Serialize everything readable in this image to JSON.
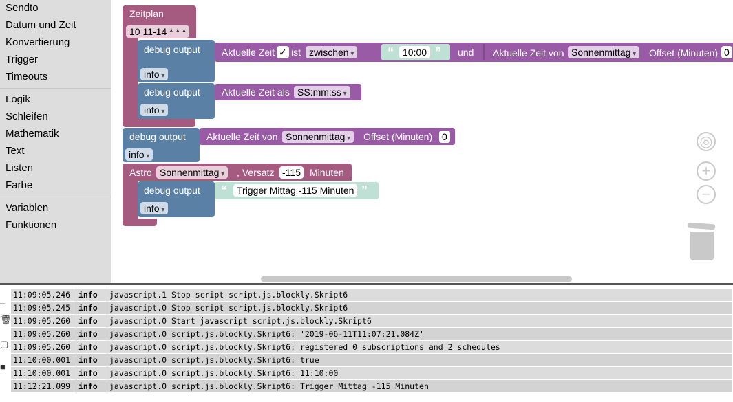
{
  "toolbox": {
    "groups": [
      [
        "Sendto",
        "Datum und Zeit",
        "Konvertierung",
        "Trigger",
        "Timeouts"
      ],
      [
        "Logik",
        "Schleifen",
        "Mathematik",
        "Text",
        "Listen",
        "Farbe"
      ],
      [
        "Variablen",
        "Funktionen"
      ]
    ]
  },
  "blocks": {
    "schedule": {
      "title": "Zeitplan",
      "cron": "10 11-14 * * *"
    },
    "debug1": {
      "label": "debug output",
      "level": "info",
      "value": {
        "prefix": "Aktuelle Zeit",
        "check": "✓",
        "ist": "ist",
        "mode": "zwischen",
        "time": "10:00",
        "und": "und",
        "from": "Aktuelle Zeit von",
        "sun": "Sonnenmittag",
        "offset": "Offset (Minuten)",
        "offset_val": "0"
      }
    },
    "debug2": {
      "label": "debug output",
      "level": "info",
      "value": {
        "prefix": "Aktuelle Zeit als",
        "format": "SS:mm:ss"
      }
    },
    "debug3": {
      "label": "debug output",
      "level": "info",
      "value": {
        "prefix": "Aktuelle Zeit von",
        "sun": "Sonnenmittag",
        "offset": "Offset (Minuten)",
        "offset_val": "0"
      }
    },
    "astro": {
      "title": "Astro",
      "sun": "Sonnenmittag",
      "versatz": ", Versatz",
      "versatz_val": "-115",
      "unit": "Minuten"
    },
    "debug4": {
      "label": "debug output",
      "level": "info",
      "text": "Trigger Mittag -115 Minuten"
    }
  },
  "log": {
    "rows": [
      [
        "11:09:05.246",
        "info",
        "javascript.1 Stop script script.js.blockly.Skript6"
      ],
      [
        "11:09:05.245",
        "info",
        "javascript.0 Stop script script.js.blockly.Skript6"
      ],
      [
        "11:09:05.260",
        "info",
        "javascript.0 Start javascript script.js.blockly.Skript6"
      ],
      [
        "11:09:05.260",
        "info",
        "javascript.0 script.js.blockly.Skript6: '2019-06-11T11:07:21.084Z'"
      ],
      [
        "11:09:05.260",
        "info",
        "javascript.0 script.js.blockly.Skript6: registered 0 subscriptions and 2 schedules"
      ],
      [
        "11:10:00.001",
        "info",
        "javascript.0 script.js.blockly.Skript6: true"
      ],
      [
        "11:10:00.001",
        "info",
        "javascript.0 script.js.blockly.Skript6: 11:10:00"
      ],
      [
        "11:12:21.099",
        "info",
        "javascript.0 script.js.blockly.Skript6: Trigger Mittag -115 Minuten"
      ]
    ]
  },
  "icons": {
    "center": "target-icon",
    "zoom_in": "zoom-in-icon",
    "zoom_out": "zoom-out-icon",
    "trash": "trash-icon"
  },
  "colors": {
    "pink": "#a55b80",
    "blue": "#5b80a5",
    "purple": "#995ba5",
    "teal": "#bfe0d4"
  }
}
